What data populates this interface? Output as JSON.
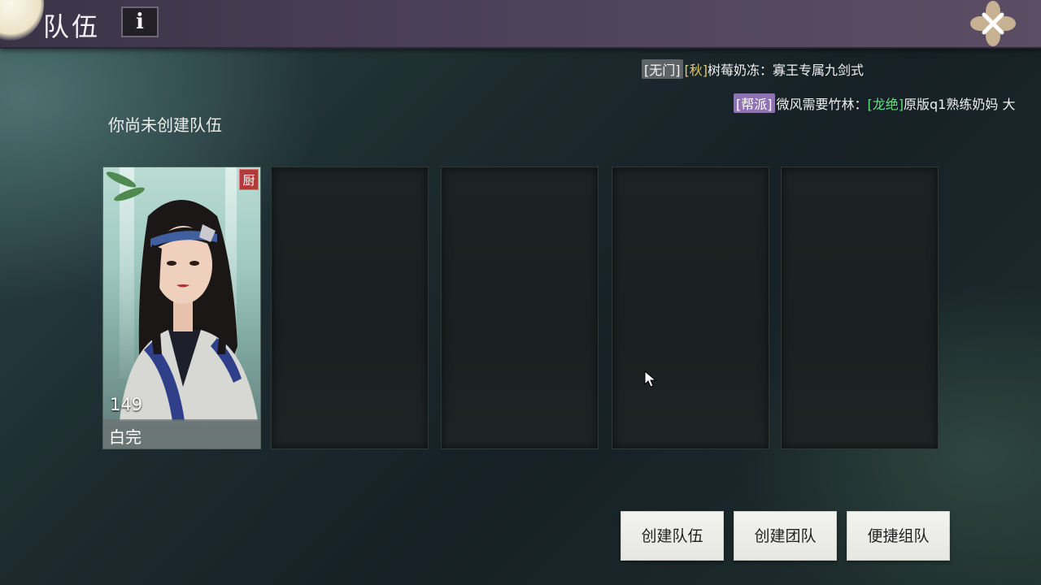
{
  "header": {
    "title": "队伍",
    "info_icon": "i"
  },
  "chat": [
    {
      "channel": "[无门]",
      "season": "[秋]",
      "speaker": "树莓奶冻",
      "message": "：寡王专属九剑式"
    },
    {
      "channel": "[帮派]",
      "speaker": "微风需要竹林：",
      "mention": "[龙绝]",
      "message": "原版q1熟练奶妈 大"
    }
  ],
  "main": {
    "notice": "你尚未创建队伍",
    "member": {
      "level": "149",
      "name": "白完",
      "badge": "厨"
    }
  },
  "buttons": {
    "create_team": "创建队伍",
    "create_group": "创建团队",
    "quick_team": "便捷组队"
  },
  "colors": {
    "header_bg": "#4a3f58",
    "tag_gray": "#5e6466",
    "tag_purple": "#8f72b4",
    "gold_text": "#e5c86a",
    "green_text": "#66e07e"
  },
  "icons": [
    "info-icon",
    "close-icon",
    "cursor-icon"
  ]
}
